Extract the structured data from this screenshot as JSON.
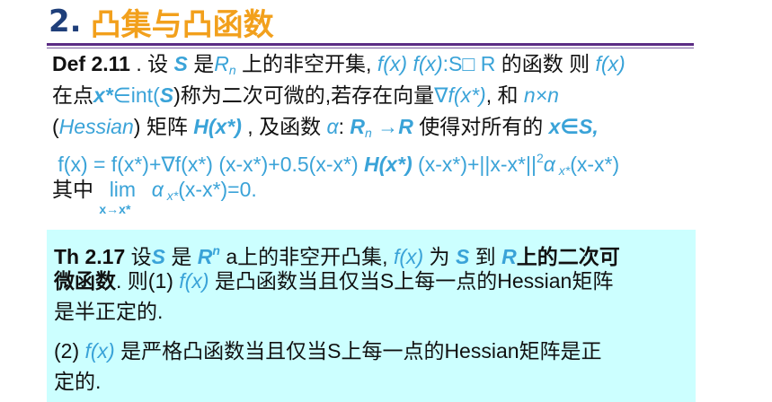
{
  "heading": {
    "number": "2",
    "dot": ".",
    "text": "凸集与凸函数"
  },
  "def": {
    "l1": [
      "Def 2.11",
      " . 设 ",
      "S",
      " 是",
      "R",
      "n",
      " 上的非空开集, ",
      "f(x)",
      " ",
      "f(x)",
      ":S",
      "□",
      "  R",
      " 的函数 则 ",
      "f(x)"
    ],
    "l2": [
      "在点",
      "x*",
      "∈int(",
      "S",
      ")称为二次可微的,若存在向量",
      "∇f(x*)",
      ", 和 ",
      "n×n"
    ],
    "l3": [
      "(",
      "Hessian",
      ") 矩阵 ",
      "H(x*)",
      " , 及函数 ",
      "α",
      ": ",
      "R",
      "n",
      " →",
      "R",
      " 使得对所有的 ",
      "x∈S,"
    ],
    "l4": [
      "f(x) = f(x*)+∇f(x*) (x-x*)+0.5(x-x*) ",
      "H(x*)",
      " (x-x*)+||x-x*||",
      "2",
      "α",
      " x*",
      "(x-x*)"
    ],
    "l5": [
      "其中 ",
      "lim",
      "x→x*",
      " α",
      " x*",
      "(x-x*)=0."
    ]
  },
  "theorem": {
    "l1": [
      "Th 2.17",
      " 设",
      "S",
      " 是 ",
      "R",
      "n",
      " a上的非空开凸集, ",
      "f(x)",
      " 为 ",
      "S",
      " 到 ",
      "R",
      "上的二次可"
    ],
    "l2": [
      "微函数",
      ". 则(1) ",
      "f(x)",
      " 是凸函数当且仅当S上每一点的Hessian矩阵"
    ],
    "l3": [
      "是半正定的."
    ],
    "l4": [
      "(2) ",
      "f(x)",
      " 是严格凸函数当且仅当S上每一点的Hessian矩阵是正"
    ],
    "l5": [
      "定的."
    ]
  },
  "colors": {
    "title_orange": "#f2a01c",
    "title_blue": "#1f3f7a",
    "math_blue": "#3aa3d8",
    "rule_purple": "#5b2c84",
    "box_cyan": "#ccffff"
  }
}
